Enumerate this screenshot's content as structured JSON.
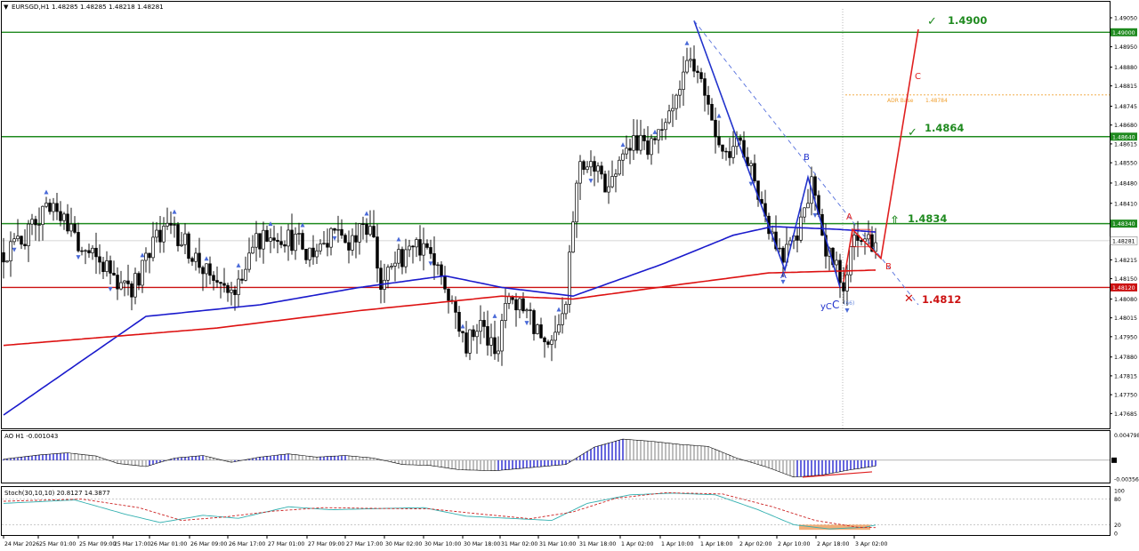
{
  "header": {
    "main": "EURSGD,H1  1.48285 1.48285 1.48218 1.48281",
    "ao": "AO H1  -0.001043",
    "stoch": "Stoch(30,10,10) 20.8127 14.3877"
  },
  "colors": {
    "bull": "#ffffff",
    "bear": "#000000",
    "ma_fast": "#1a1acc",
    "ma_slow": "#dd1111",
    "level_green": "#1f8a1f",
    "level_red": "#cc1111",
    "projection": "#e02020",
    "wave": "#2233cc",
    "fractal": "#4a6ad8",
    "adr": "#f0a030",
    "stoch_k": "#33b0b0",
    "stoch_d": "#cc2222",
    "highlight": "#f0a060"
  },
  "chart_data": [
    {
      "type": "candlestick",
      "symbol": "EURSGD",
      "timeframe": "H1",
      "ylim": [
        1.4764,
        1.4905
      ],
      "y_ticks": [
        "1.49050",
        "1.48950",
        "1.48880",
        "1.48815",
        "1.48745",
        "1.48680",
        "1.48615",
        "1.48550",
        "1.48480",
        "1.48410",
        "1.48280",
        "1.48215",
        "1.48150",
        "1.48080",
        "1.48015",
        "1.47950",
        "1.47880",
        "1.47815",
        "1.47750",
        "1.47685"
      ],
      "x_ticks": [
        "24 Mar 2026",
        "25 Mar 01:00",
        "25 Mar 09:00",
        "25 Mar 17:00",
        "26 Mar 01:00",
        "26 Mar 09:00",
        "26 Mar 17:00",
        "27 Mar 01:00",
        "27 Mar 09:00",
        "27 Mar 17:00",
        "30 Mar 02:00",
        "30 Mar 10:00",
        "30 Mar 18:00",
        "31 Mar 02:00",
        "31 Mar 10:00",
        "31 Mar 18:00",
        "1 Apr 02:00",
        "1 Apr 10:00",
        "1 Apr 18:00",
        "2 Apr 02:00",
        "2 Apr 10:00",
        "2 Apr 18:00",
        "3 Apr 02:00"
      ],
      "last_price": "1.48281",
      "horizontal_levels": [
        {
          "price": 1.49,
          "label": "1.4900",
          "tag": "1.49000",
          "color": "green"
        },
        {
          "price": 1.4864,
          "label": "1.4864",
          "tag": "1.48640",
          "color": "green"
        },
        {
          "price": 1.4834,
          "label": "1.4834",
          "tag": "1.48340",
          "color": "green"
        },
        {
          "price": 1.4812,
          "label": "1.4812",
          "tag": "1.48120",
          "color": "red"
        }
      ],
      "adr": {
        "label": "ADR Base",
        "value": "1.48784",
        "price": 1.48784
      },
      "wave_labels": [
        "A",
        "B",
        "yC",
        "C",
        "(66)"
      ],
      "projection_labels": [
        "A",
        "B",
        "C"
      ],
      "ohlc_anchors": [
        {
          "t": 0,
          "c": 1.4824
        },
        {
          "t": 6,
          "c": 1.4829
        },
        {
          "t": 12,
          "c": 1.4838
        },
        {
          "t": 18,
          "c": 1.4835
        },
        {
          "t": 22,
          "c": 1.4825
        },
        {
          "t": 30,
          "c": 1.4818
        },
        {
          "t": 36,
          "c": 1.481
        },
        {
          "t": 42,
          "c": 1.4828
        },
        {
          "t": 48,
          "c": 1.4832
        },
        {
          "t": 54,
          "c": 1.4822
        },
        {
          "t": 58,
          "c": 1.4815
        },
        {
          "t": 64,
          "c": 1.4808
        },
        {
          "t": 70,
          "c": 1.4826
        },
        {
          "t": 76,
          "c": 1.4831
        },
        {
          "t": 82,
          "c": 1.4828
        },
        {
          "t": 88,
          "c": 1.4822
        },
        {
          "t": 92,
          "c": 1.4832
        },
        {
          "t": 98,
          "c": 1.4826
        },
        {
          "t": 103,
          "c": 1.4836
        },
        {
          "t": 106,
          "c": 1.4812
        },
        {
          "t": 110,
          "c": 1.482
        },
        {
          "t": 116,
          "c": 1.4828
        },
        {
          "t": 122,
          "c": 1.482
        },
        {
          "t": 126,
          "c": 1.4806
        },
        {
          "t": 130,
          "c": 1.4792
        },
        {
          "t": 134,
          "c": 1.48
        },
        {
          "t": 138,
          "c": 1.4788
        },
        {
          "t": 142,
          "c": 1.481
        },
        {
          "t": 146,
          "c": 1.4806
        },
        {
          "t": 150,
          "c": 1.4798
        },
        {
          "t": 154,
          "c": 1.479
        },
        {
          "t": 158,
          "c": 1.4805
        },
        {
          "t": 160,
          "c": 1.4836
        },
        {
          "t": 162,
          "c": 1.4856
        },
        {
          "t": 166,
          "c": 1.4852
        },
        {
          "t": 170,
          "c": 1.4845
        },
        {
          "t": 174,
          "c": 1.4858
        },
        {
          "t": 178,
          "c": 1.4862
        },
        {
          "t": 182,
          "c": 1.486
        },
        {
          "t": 186,
          "c": 1.4866
        },
        {
          "t": 190,
          "c": 1.4878
        },
        {
          "t": 193,
          "c": 1.4892
        },
        {
          "t": 195,
          "c": 1.4888
        },
        {
          "t": 199,
          "c": 1.4866
        },
        {
          "t": 203,
          "c": 1.4855
        },
        {
          "t": 207,
          "c": 1.4862
        },
        {
          "t": 211,
          "c": 1.4848
        },
        {
          "t": 215,
          "c": 1.4834
        },
        {
          "t": 219,
          "c": 1.4822
        },
        {
          "t": 223,
          "c": 1.483
        },
        {
          "t": 227,
          "c": 1.4848
        },
        {
          "t": 230,
          "c": 1.4828
        },
        {
          "t": 234,
          "c": 1.4818
        },
        {
          "t": 236,
          "c": 1.4814
        },
        {
          "t": 238,
          "c": 1.4826
        },
        {
          "t": 242,
          "c": 1.4829
        },
        {
          "t": 245,
          "c": 1.4828
        }
      ],
      "series": [
        {
          "name": "MA fast (blue)",
          "anchors": [
            {
              "t": 0,
              "v": 1.4768
            },
            {
              "t": 40,
              "v": 1.4802
            },
            {
              "t": 72,
              "v": 1.4806
            },
            {
              "t": 100,
              "v": 1.4812
            },
            {
              "t": 124,
              "v": 1.4816
            },
            {
              "t": 140,
              "v": 1.4812
            },
            {
              "t": 160,
              "v": 1.4809
            },
            {
              "t": 185,
              "v": 1.482
            },
            {
              "t": 205,
              "v": 1.483
            },
            {
              "t": 216,
              "v": 1.4833
            },
            {
              "t": 235,
              "v": 1.4832
            },
            {
              "t": 246,
              "v": 1.4831
            }
          ]
        },
        {
          "name": "MA slow (red)",
          "anchors": [
            {
              "t": 0,
              "v": 1.4792
            },
            {
              "t": 60,
              "v": 1.4798
            },
            {
              "t": 100,
              "v": 1.4804
            },
            {
              "t": 140,
              "v": 1.4809
            },
            {
              "t": 160,
              "v": 1.4808
            },
            {
              "t": 190,
              "v": 1.4813
            },
            {
              "t": 215,
              "v": 1.4817
            },
            {
              "t": 246,
              "v": 1.4818
            }
          ]
        }
      ]
    },
    {
      "type": "bar",
      "name": "AO H1",
      "value": "-0.001043",
      "y_ticks": [
        "0.004798",
        "-0.003568"
      ],
      "ylim": [
        -0.0039,
        0.0052
      ],
      "anchors": [
        {
          "t": 0,
          "v": 0.0002
        },
        {
          "t": 10,
          "v": 0.001
        },
        {
          "t": 18,
          "v": 0.0014
        },
        {
          "t": 26,
          "v": 0.0008
        },
        {
          "t": 32,
          "v": -0.0006
        },
        {
          "t": 40,
          "v": -0.0012
        },
        {
          "t": 48,
          "v": 0.0004
        },
        {
          "t": 56,
          "v": 0.0009
        },
        {
          "t": 64,
          "v": -0.0004
        },
        {
          "t": 72,
          "v": 0.0006
        },
        {
          "t": 80,
          "v": 0.0012
        },
        {
          "t": 88,
          "v": 0.0006
        },
        {
          "t": 96,
          "v": 0.0009
        },
        {
          "t": 104,
          "v": 0.0004
        },
        {
          "t": 112,
          "v": -0.0008
        },
        {
          "t": 120,
          "v": -0.001
        },
        {
          "t": 128,
          "v": -0.0018
        },
        {
          "t": 138,
          "v": -0.002
        },
        {
          "t": 148,
          "v": -0.0014
        },
        {
          "t": 158,
          "v": -0.0008
        },
        {
          "t": 166,
          "v": 0.0025
        },
        {
          "t": 174,
          "v": 0.004
        },
        {
          "t": 182,
          "v": 0.0036
        },
        {
          "t": 190,
          "v": 0.003
        },
        {
          "t": 198,
          "v": 0.0026
        },
        {
          "t": 206,
          "v": 0.0004
        },
        {
          "t": 214,
          "v": -0.0012
        },
        {
          "t": 222,
          "v": -0.0032
        },
        {
          "t": 230,
          "v": -0.0028
        },
        {
          "t": 238,
          "v": -0.0018
        },
        {
          "t": 246,
          "v": -0.001
        }
      ]
    },
    {
      "type": "line",
      "name": "Stoch(30,10,10)",
      "values_text": "20.8127 14.3877",
      "y_ticks": [
        "100",
        "80",
        "20",
        "0"
      ],
      "ylim": [
        0,
        100
      ],
      "series": [
        {
          "name": "K",
          "anchors": [
            {
              "t": 0,
              "v": 70
            },
            {
              "t": 20,
              "v": 78
            },
            {
              "t": 34,
              "v": 45
            },
            {
              "t": 44,
              "v": 25
            },
            {
              "t": 56,
              "v": 42
            },
            {
              "t": 66,
              "v": 35
            },
            {
              "t": 80,
              "v": 62
            },
            {
              "t": 92,
              "v": 55
            },
            {
              "t": 106,
              "v": 58
            },
            {
              "t": 118,
              "v": 60
            },
            {
              "t": 130,
              "v": 40
            },
            {
              "t": 142,
              "v": 35
            },
            {
              "t": 154,
              "v": 30
            },
            {
              "t": 164,
              "v": 70
            },
            {
              "t": 176,
              "v": 90
            },
            {
              "t": 188,
              "v": 94
            },
            {
              "t": 200,
              "v": 90
            },
            {
              "t": 212,
              "v": 55
            },
            {
              "t": 222,
              "v": 20
            },
            {
              "t": 232,
              "v": 10
            },
            {
              "t": 242,
              "v": 14
            },
            {
              "t": 246,
              "v": 21
            }
          ]
        },
        {
          "name": "D",
          "anchors": [
            {
              "t": 0,
              "v": 75
            },
            {
              "t": 22,
              "v": 80
            },
            {
              "t": 38,
              "v": 60
            },
            {
              "t": 50,
              "v": 30
            },
            {
              "t": 62,
              "v": 38
            },
            {
              "t": 76,
              "v": 52
            },
            {
              "t": 90,
              "v": 60
            },
            {
              "t": 106,
              "v": 58
            },
            {
              "t": 120,
              "v": 57
            },
            {
              "t": 134,
              "v": 45
            },
            {
              "t": 148,
              "v": 34
            },
            {
              "t": 160,
              "v": 50
            },
            {
              "t": 172,
              "v": 82
            },
            {
              "t": 186,
              "v": 95
            },
            {
              "t": 202,
              "v": 92
            },
            {
              "t": 216,
              "v": 62
            },
            {
              "t": 228,
              "v": 30
            },
            {
              "t": 240,
              "v": 14
            },
            {
              "t": 246,
              "v": 13
            }
          ]
        }
      ]
    }
  ]
}
